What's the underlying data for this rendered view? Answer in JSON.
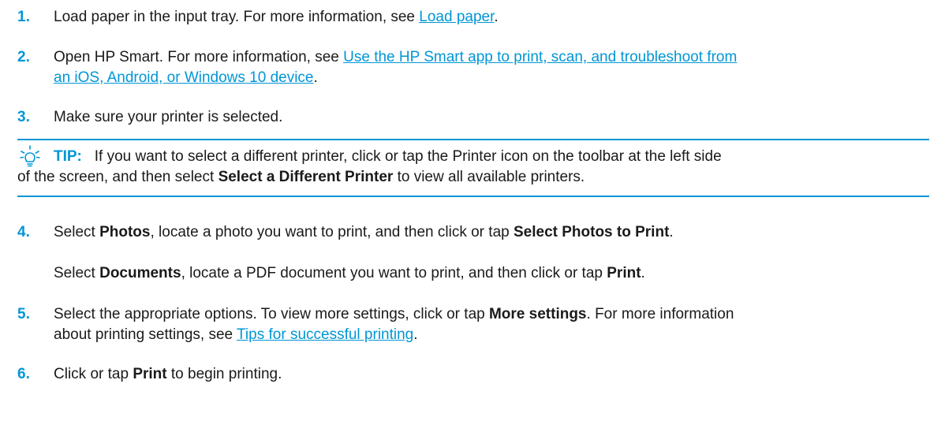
{
  "step1": {
    "number": "1.",
    "text_before": "Load paper in the input tray. For more information, see ",
    "link": "Load paper",
    "text_after": "."
  },
  "step2": {
    "number": "2.",
    "text_before": "Open HP Smart. For more information, see ",
    "link_line1": "Use the HP Smart app to print, scan, and troubleshoot from",
    "link_line2": "an iOS, Android, or Windows 10 device",
    "text_after": "."
  },
  "step3": {
    "number": "3.",
    "text": "Make sure your printer is selected."
  },
  "tip": {
    "icon": "lightbulb-icon",
    "label": "TIP:",
    "line1": "If you want to select a different printer, click or tap the Printer icon on the toolbar at the left side",
    "line2_before": "of the screen, and then select ",
    "line2_bold": "Select a Different Printer",
    "line2_after": " to view all available printers."
  },
  "step4": {
    "number": "4.",
    "p1_a": "Select ",
    "p1_b": "Photos",
    "p1_c": ", locate a photo you want to print, and then click or tap ",
    "p1_d": "Select Photos to Print",
    "p1_e": ".",
    "p2_a": "Select ",
    "p2_b": "Documents",
    "p2_c": ", locate a PDF document you want to print, and then click or tap ",
    "p2_d": "Print",
    "p2_e": "."
  },
  "step5": {
    "number": "5.",
    "l1_a": "Select the appropriate options. To view more settings, click or tap ",
    "l1_b": "More settings",
    "l1_c": ". For more information",
    "l2_a": "about printing settings, see ",
    "l2_link": "Tips for successful printing",
    "l2_c": "."
  },
  "step6": {
    "number": "6.",
    "a": "Click or tap ",
    "b": "Print",
    "c": " to begin printing."
  },
  "colors": {
    "accent": "#0096d6",
    "text": "#1a1a1a"
  }
}
